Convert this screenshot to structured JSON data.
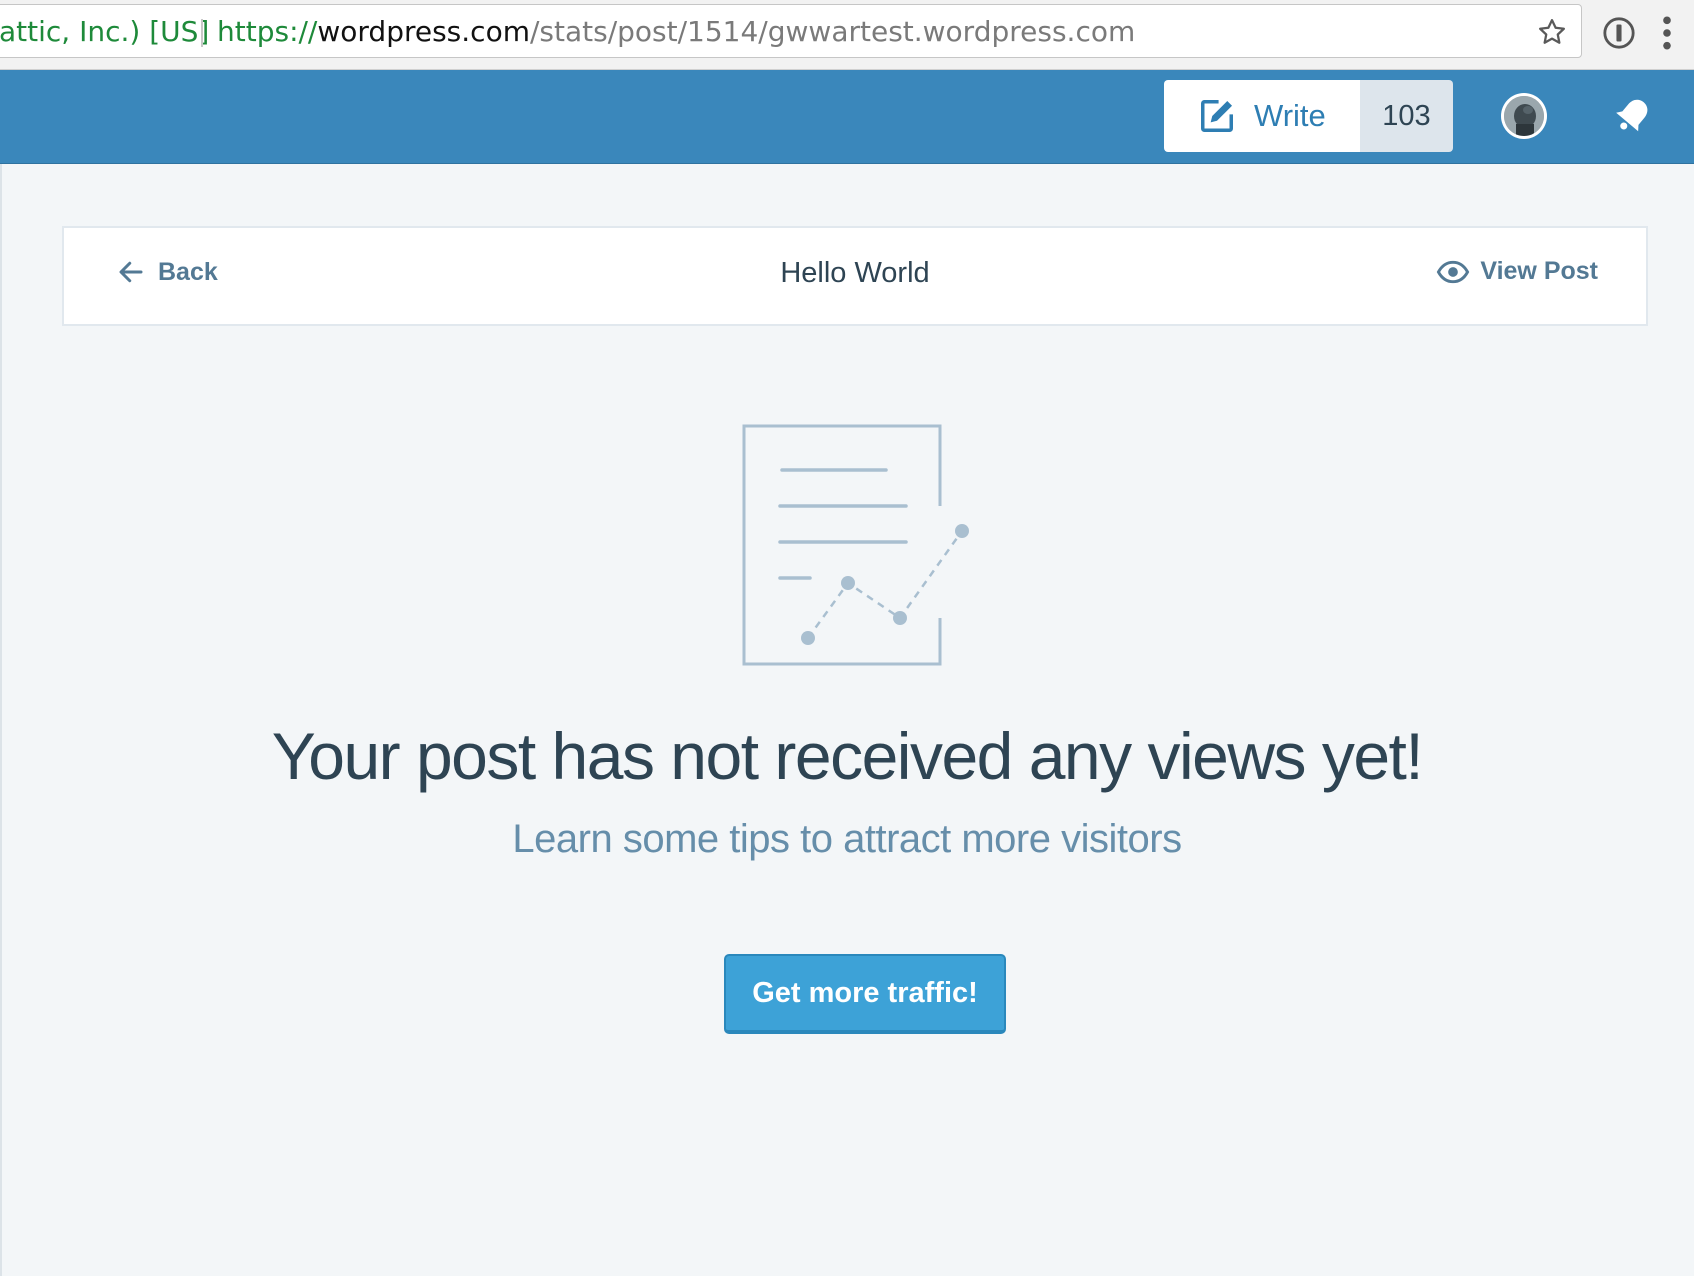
{
  "browser": {
    "cert_label": "attic, Inc.) [US]",
    "url_scheme": "https://",
    "url_host": "wordpress.com",
    "url_path": "/stats/post/1514/gwwartest.wordpress.com"
  },
  "masterbar": {
    "write_label": "Write",
    "drafts_count": "103"
  },
  "header": {
    "back_label": "Back",
    "title": "Hello World",
    "view_post_label": "View Post"
  },
  "empty_state": {
    "title": "Your post has not received any views yet!",
    "subtitle": "Learn some tips to attract more visitors",
    "button_label": "Get more traffic!"
  },
  "colors": {
    "masterbar_blue": "#3a87bb",
    "page_background": "#f3f6f8",
    "primary_button": "#3da2d7",
    "link_gray_blue": "#537994"
  }
}
